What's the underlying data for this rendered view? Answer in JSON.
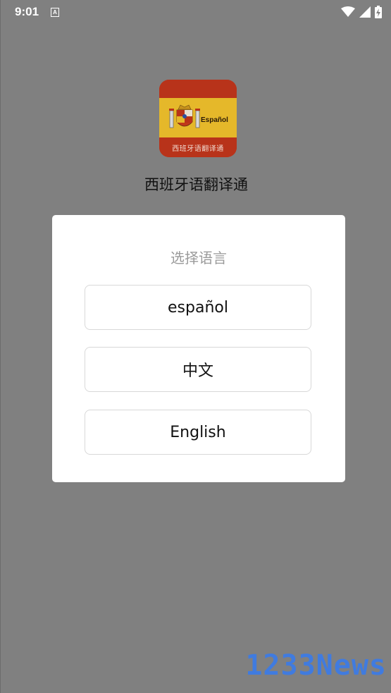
{
  "status_bar": {
    "time": "9:01",
    "a_indicator": "A",
    "icons": [
      "wifi-icon",
      "signal-icon",
      "battery-charging-icon"
    ]
  },
  "app": {
    "icon_label_word": "Español",
    "icon_caption": "西班牙语翻译通",
    "title": "西班牙语翻译通"
  },
  "dialog": {
    "title": "选择语言",
    "options": [
      {
        "label": "español"
      },
      {
        "label": "中文"
      },
      {
        "label": "English"
      }
    ]
  },
  "watermark": {
    "text": "1233News"
  },
  "colors": {
    "overlay": "#808080",
    "dialog_bg": "#ffffff",
    "dialog_title": "#9a9a9a",
    "button_border": "#d8d8d8",
    "flag_red": "#b8331a",
    "flag_yellow": "#e5b82a",
    "watermark": "#3d7be5"
  }
}
